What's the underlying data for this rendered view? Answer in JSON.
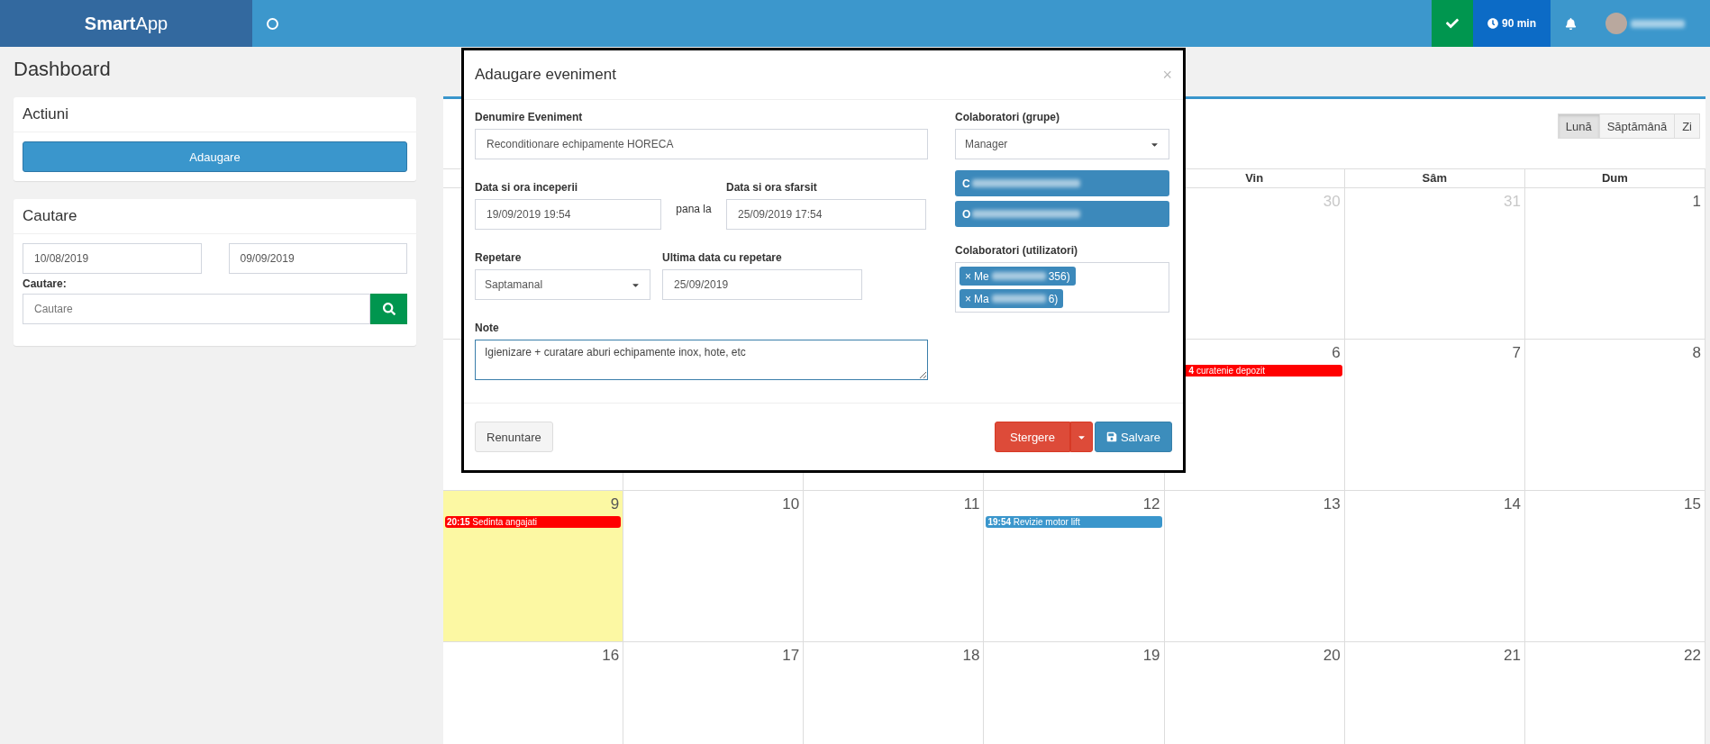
{
  "topbar": {
    "brand": "**Smart**App",
    "timer": "90 min"
  },
  "page_title": "Dashboard",
  "actions_card": {
    "title": "Actiuni",
    "button": "Adaugare"
  },
  "search_card": {
    "title": "Cautare",
    "date_from": "10/08/2019",
    "date_to": "09/09/2019",
    "search_label": "Cautare:",
    "search_field": {
      "placeholder": "Cautare"
    }
  },
  "calendar": {
    "views": [
      {
        "label": "Lună",
        "selected": true
      },
      {
        "label": "Săptămână",
        "selected": false
      },
      {
        "label": "Zi",
        "selected": false
      }
    ],
    "headers": [
      "Vin",
      "Sâm",
      "Dum"
    ],
    "weeks": [
      [
        {
          "day": "30",
          "other_month": true,
          "today": false
        },
        {
          "day": "31",
          "other_month": true,
          "today": false
        },
        {
          "day": "1",
          "other_month": false,
          "today": false
        }
      ],
      [
        {
          "day": "6",
          "other_month": false,
          "today": false,
          "events": [
            {
              "time": "4",
              "title": "curatenie depozit",
              "color": "#ff0000",
              "continued": true
            }
          ]
        },
        {
          "day": "7",
          "other_month": false,
          "today": false
        },
        {
          "day": "8",
          "other_month": false,
          "today": false
        }
      ],
      [
        {
          "day": "9",
          "other_month": false,
          "today": true,
          "events": [
            {
              "time": "20:15",
              "title": "Sedinta angajati",
              "color": "#ff0000"
            }
          ]
        },
        {
          "day": "10",
          "other_month": false,
          "today": false
        },
        {
          "day": "11",
          "other_month": false,
          "today": false
        },
        {
          "day": "12",
          "other_month": false,
          "today": false,
          "events": [
            {
              "time": "19:54",
              "title": "Revizie motor lift",
              "color": "#3a96cc"
            }
          ]
        },
        {
          "day": "13",
          "other_month": false,
          "today": false
        },
        {
          "day": "14",
          "other_month": false,
          "today": false
        },
        {
          "day": "15",
          "other_month": false,
          "today": false
        }
      ],
      [
        {
          "day": "16",
          "other_month": false,
          "today": false
        },
        {
          "day": "17",
          "other_month": false,
          "today": false
        },
        {
          "day": "18",
          "other_month": false,
          "today": false
        },
        {
          "day": "19",
          "other_month": false,
          "today": false
        },
        {
          "day": "20",
          "other_month": false,
          "today": false
        },
        {
          "day": "21",
          "other_month": false,
          "today": false
        },
        {
          "day": "22",
          "other_month": false,
          "today": false
        }
      ]
    ]
  },
  "modal": {
    "title": "Adaugare eveniment",
    "close": "×",
    "name_field": {
      "label": "Denumire Eveniment",
      "value": "Reconditionare echipamente HORECA"
    },
    "start_field": {
      "label": "Data si ora inceperii",
      "value": "19/09/2019 19:54"
    },
    "range_separator": "pana la",
    "end_field": {
      "label": "Data si ora sfarsit",
      "value": "25/09/2019 17:54"
    },
    "repeat_field": {
      "label": "Repetare",
      "value": "Saptamanal"
    },
    "repeat_until_field": {
      "label": "Ultima data cu repetare",
      "value": "25/09/2019"
    },
    "notes_field": {
      "label": "Note",
      "value": "Igienizare + curatare aburi echipamente inox, hote, etc"
    },
    "groups_field": {
      "label": "Colaboratori (grupe)",
      "value": "Manager",
      "chips": [
        {
          "start": "C"
        },
        {
          "start": "O"
        }
      ]
    },
    "users_field": {
      "label": "Colaboratori (utilizatori)",
      "chips": [
        {
          "remove": "×",
          "start": "Me",
          "end": "356)"
        },
        {
          "remove": "×",
          "start": "Ma",
          "end": "6)"
        }
      ]
    },
    "buttons": {
      "cancel": "Renuntare",
      "delete": "Stergere",
      "save": "Salvare"
    }
  }
}
